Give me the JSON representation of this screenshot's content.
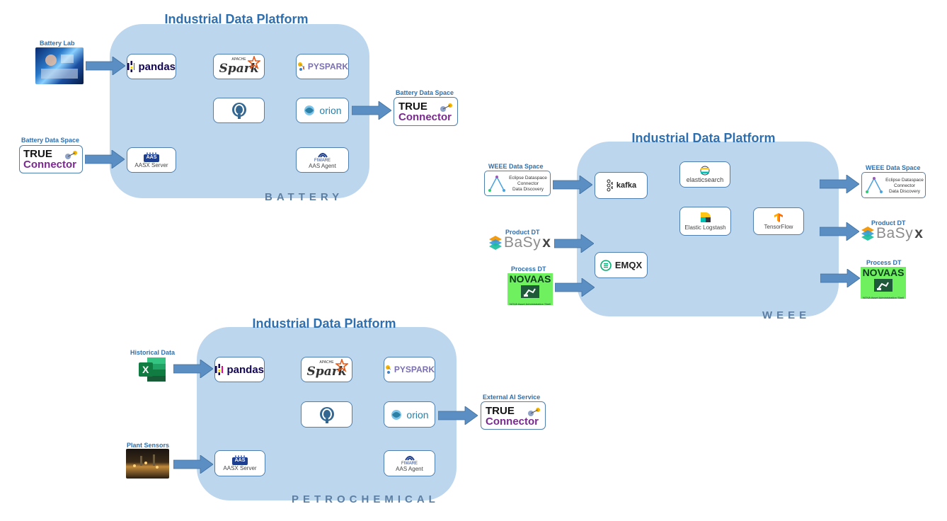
{
  "battery": {
    "title": "Industrial Data Platform",
    "domain": "BATTERY",
    "inputs": {
      "lab_label": "Battery Lab",
      "space_label": "Battery Data Space"
    },
    "output": {
      "label": "Battery Data Space"
    },
    "cards": {
      "pandas": "pandas",
      "spark_top": "APACHE",
      "spark": "Spark",
      "pyspark": "PYSPARK",
      "orion": "orion",
      "aas": "AAS",
      "aas_server": "AASX Server",
      "fiware": "FIWARE",
      "aas_agent": "AAS Agent"
    }
  },
  "weee": {
    "title": "Industrial Data Platform",
    "domain": "WEEE",
    "inputs": {
      "space_label": "WEEE Data Space",
      "product_label": "Product DT",
      "process_label": "Process DT"
    },
    "outputs": {
      "space_label": "WEEE Data Space",
      "product_label": "Product DT",
      "process_label": "Process DT"
    },
    "cards": {
      "kafka": "kafka",
      "emqx": "EMQX",
      "elasticsearch": "elasticsearch",
      "logstash": "Elastic Logstash",
      "tensorflow": "TensorFlow"
    }
  },
  "petro": {
    "title": "Industrial Data Platform",
    "domain": "PETROCHEMICAL",
    "inputs": {
      "historical_label": "Historical Data",
      "sensors_label": "Plant Sensors"
    },
    "output": {
      "label": "External AI Service"
    },
    "cards": {
      "pandas": "pandas",
      "spark_top": "APACHE",
      "spark": "Spark",
      "pyspark": "PYSPARK",
      "orion": "orion",
      "aas": "AAS",
      "aas_server": "AASX Server",
      "fiware": "FIWARE",
      "aas_agent": "AAS Agent"
    }
  },
  "logos": {
    "true_connector_l1": "TRUE",
    "true_connector_l2": "Connector",
    "edc_lines": [
      "Eclipse Dataspace",
      "Connector",
      "Data Discovery"
    ],
    "basyx_text": "BaSy",
    "basyx_x": "x",
    "novaas_text": "NOVAAS",
    "novaas_sub": "NOVA Asset Administration Shell",
    "excel_letter": "X"
  },
  "colors": {
    "platform_bg": "#bcd6ee",
    "title": "#2e6faf",
    "arrow": "#5b8fc4",
    "line": "#4f7fae"
  }
}
